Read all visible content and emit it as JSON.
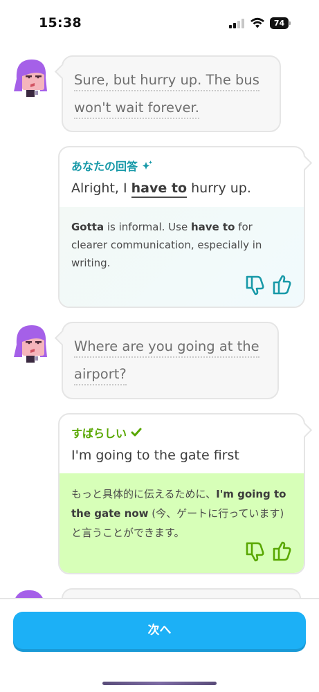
{
  "status_bar": {
    "time": "15:38",
    "battery": "74",
    "icons": [
      "cellular-signal-icon",
      "wifi-icon",
      "battery-icon"
    ]
  },
  "colors": {
    "accent_blue": "#1cb0f6",
    "teal_label": "#1899a8",
    "green_label": "#58a700",
    "feedback_teal_bg": "#f0fafc",
    "feedback_green_bg": "#d7ffb8",
    "character_hair": "#a560e8"
  },
  "conversation": {
    "messages": [
      {
        "character_line_1": "Sure, but hurry up. The bus",
        "character_line_2": "won't wait forever.",
        "answer_label": "あなたの回答",
        "answer_icon": "sparkle-icon",
        "answer_prefix": "Alright, I ",
        "answer_highlight": "have to",
        "answer_suffix": " hurry up.",
        "feedback": {
          "w1": "Gotta",
          "t1": " is informal. Use ",
          "w2": "have to",
          "t2": " for clearer communication, especially in writing."
        }
      },
      {
        "character_line_1": "Where are you going at the",
        "character_line_2": "airport?",
        "answer_label": "すばらしい",
        "answer_icon": "checkmark-icon",
        "answer_text": "I'm going to the gate first",
        "feedback": {
          "t1": "もっと具体的に伝えるために、",
          "w1": "I'm going to the gate now",
          "t2": " (今、ゲートに行っています)と言うことができます。"
        }
      }
    ]
  },
  "footer": {
    "next_button_label": "次へ"
  }
}
